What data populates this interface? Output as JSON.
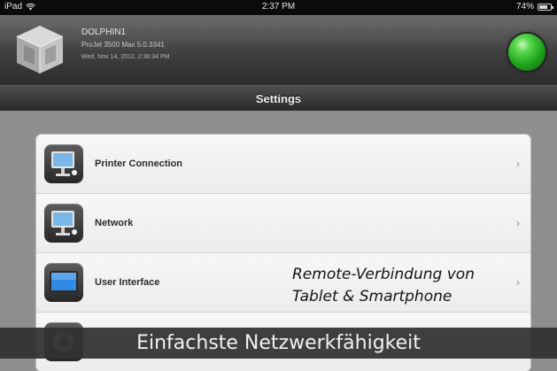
{
  "status_bar": {
    "device": "iPad",
    "time": "2:37 PM",
    "battery_percent": "74%",
    "battery_level": 0.74
  },
  "printer": {
    "name": "DOLPHIN1",
    "model": "ProJet 3500 Max 5.0.3341",
    "datetime": "Wed, Nov 14, 2012, 2:38:34 PM",
    "status_color": "#2fbf2a"
  },
  "nav": {
    "title": "Settings"
  },
  "settings": {
    "items": [
      {
        "label": "Printer Connection",
        "icon": "monitor-network-icon"
      },
      {
        "label": "Network",
        "icon": "monitor-network-icon"
      },
      {
        "label": "User Interface",
        "icon": "monitor-icon"
      },
      {
        "label": "",
        "icon": "settings-icon"
      }
    ],
    "chevron": "›"
  },
  "overlay": {
    "line1": "Remote-Verbindung von",
    "line2": "Tablet & Smartphone"
  },
  "caption": {
    "text": "Einfachste Netzwerkfähigkeit"
  }
}
